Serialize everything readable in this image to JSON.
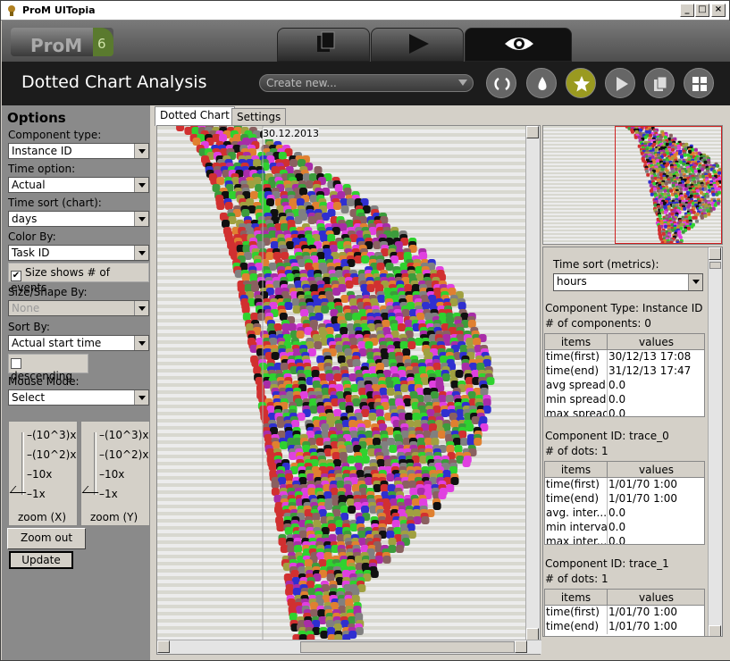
{
  "window": {
    "title": "ProM UITopia"
  },
  "logo": {
    "text": "ProM",
    "version": "6"
  },
  "header": {
    "title": "Dotted Chart Analysis",
    "create_placeholder": "Create new...",
    "tab_icons": [
      "stack-icon",
      "play-icon",
      "eye-icon"
    ],
    "action_icons": [
      "refresh-icon",
      "drop-icon",
      "star-icon",
      "play-icon",
      "copy-icon",
      "grid-icon"
    ]
  },
  "options": {
    "heading": "Options",
    "component_type_label": "Component type:",
    "component_type": "Instance ID",
    "time_option_label": "Time option:",
    "time_option": "Actual",
    "time_sort_label": "Time sort (chart):",
    "time_sort": "days",
    "color_by_label": "Color By:",
    "color_by": "Task ID",
    "size_shows_label": "Size shows # of events",
    "size_shape_label": "Size/Shape By:",
    "size_shape": "None",
    "sort_by_label": "Sort By:",
    "sort_by": "Actual start time",
    "descending_label": "descending",
    "mouse_mode_label": "Mouse Mode:",
    "mouse_mode": "Select",
    "zoom_ticks": [
      "(10^3)x",
      "(10^2)x",
      "10x",
      "1x"
    ],
    "zoom_x_label": "zoom (X)",
    "zoom_y_label": "zoom (Y)",
    "zoom_out_label": "Zoom out",
    "update_label": "Update"
  },
  "tabs": {
    "dotted_chart": "Dotted Chart",
    "settings": "Settings"
  },
  "chart": {
    "date_label": "30.12.2013"
  },
  "colors": {
    "dots": [
      "#d13030",
      "#3c9c3c",
      "#2fd22f",
      "#a82ca8",
      "#e040e0",
      "#2f2fd0",
      "#a0a040",
      "#8a6060",
      "#101010",
      "#e08030",
      "#808080"
    ]
  },
  "metrics": {
    "time_sort_label": "Time sort (metrics):",
    "time_sort": "hours",
    "summary": {
      "title": "Component Type: Instance ID",
      "count": "# of components: 0",
      "headers": [
        "items",
        "values"
      ],
      "rows": [
        [
          "time(first)",
          "30/12/13 17:08"
        ],
        [
          "time(end)",
          "31/12/13 17:47"
        ],
        [
          "avg spread",
          "0.0"
        ],
        [
          "min spread",
          "0.0"
        ],
        [
          "max spread",
          "0.0"
        ]
      ]
    },
    "components": [
      {
        "title": "Component ID: trace_0",
        "count": "# of dots: 1",
        "headers": [
          "items",
          "values"
        ],
        "rows": [
          [
            "time(first)",
            "1/01/70 1:00"
          ],
          [
            "time(end)",
            "1/01/70 1:00"
          ],
          [
            "avg. inter...",
            "0.0"
          ],
          [
            "min interval",
            "0.0"
          ],
          [
            "max inter...",
            "0.0"
          ]
        ]
      },
      {
        "title": "Component ID: trace_1",
        "count": "# of dots: 1",
        "headers": [
          "items",
          "values"
        ],
        "rows": [
          [
            "time(first)",
            "1/01/70 1:00"
          ],
          [
            "time(end)",
            "1/01/70 1:00"
          ]
        ]
      }
    ]
  }
}
